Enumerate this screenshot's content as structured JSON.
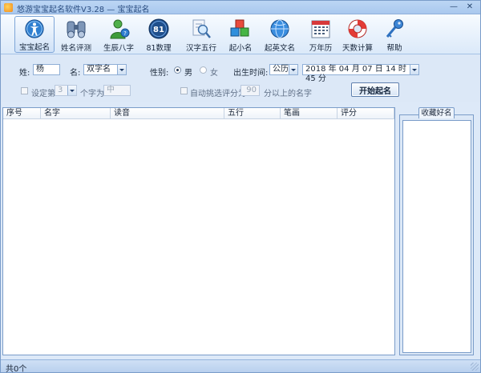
{
  "window": {
    "title": "悠游宝宝起名软件V3.28  —  宝宝起名",
    "minimize": "—",
    "close": "✕"
  },
  "toolbar": [
    {
      "label": "宝宝起名",
      "icon": "baby-icon",
      "active": true
    },
    {
      "label": "姓名评测",
      "icon": "binoculars-icon",
      "active": false
    },
    {
      "label": "生辰八字",
      "icon": "person-icon",
      "active": false
    },
    {
      "label": "81数理",
      "icon": "number-81-icon",
      "active": false
    },
    {
      "label": "汉字五行",
      "icon": "magnifier-icon",
      "active": false
    },
    {
      "label": "起小名",
      "icon": "cubes-icon",
      "active": false
    },
    {
      "label": "起英文名",
      "icon": "globe-icon",
      "active": false
    },
    {
      "label": "万年历",
      "icon": "calendar-icon",
      "active": false
    },
    {
      "label": "天数计算",
      "icon": "lifebuoy-icon",
      "active": false
    },
    {
      "label": "帮助",
      "icon": "key-icon",
      "active": false
    }
  ],
  "form": {
    "surname_label": "姓:",
    "surname_value": "杨",
    "name_label": "名:",
    "name_type": "双字名",
    "gender_label": "性别:",
    "gender_male": "男",
    "gender_female": "女",
    "birth_label": "出生时间:",
    "calendar_type": "公历",
    "birth_datetime": "2018 年 04 月 07 日  14 时 45 分",
    "set_nth_label": "设定第",
    "nth_value": "3",
    "nth_suffix": "个字为",
    "nth_char": "中",
    "auto_pick_label": "自动挑选评分为",
    "score_value": "90",
    "score_suffix": "分以上的名字",
    "start_button": "开始起名"
  },
  "table": {
    "columns": [
      "序号",
      "名字",
      "读音",
      "五行",
      "笔画",
      "评分"
    ],
    "rows": []
  },
  "favorites": {
    "tab_label": "收藏好名"
  },
  "status": {
    "text": "共0个"
  }
}
